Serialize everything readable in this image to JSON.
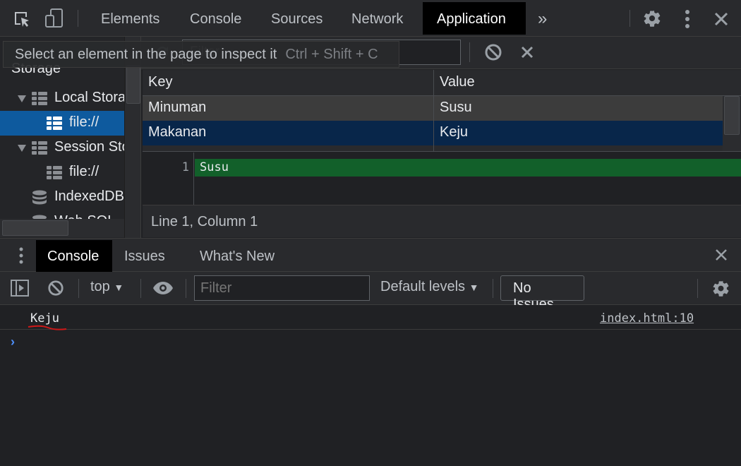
{
  "topbar": {
    "tabs": [
      {
        "label": "Elements",
        "active": false
      },
      {
        "label": "Console",
        "active": false
      },
      {
        "label": "Sources",
        "active": false
      },
      {
        "label": "Network",
        "active": false
      },
      {
        "label": "Application",
        "active": true
      }
    ],
    "more_tabs": "»",
    "icons": [
      "inspect-element-icon",
      "device-toolbar-icon",
      "settings-icon",
      "more-vertical-icon",
      "close-icon"
    ]
  },
  "tooltip": {
    "text": "Select an element in the page to inspect it",
    "shortcut": "Ctrl + Shift + C"
  },
  "app_toolbar": {
    "filter_placeholder": "Filter"
  },
  "sidebar": {
    "section_title": "Storage",
    "items": [
      {
        "label": "Local Storage",
        "icon": "grid",
        "expanded": true,
        "level": 0
      },
      {
        "label": "file://",
        "icon": "grid",
        "selected": true,
        "level": 1
      },
      {
        "label": "Session Storage",
        "icon": "grid",
        "expanded": true,
        "level": 0
      },
      {
        "label": "file://",
        "icon": "grid",
        "level": 1
      },
      {
        "label": "IndexedDB",
        "icon": "database",
        "level": 0
      },
      {
        "label": "Web SQL",
        "icon": "database",
        "level": 0
      }
    ]
  },
  "table": {
    "columns": [
      "Key",
      "Value"
    ],
    "rows": [
      {
        "key": "Minuman",
        "value": "Susu"
      },
      {
        "key": "Makanan",
        "value": "Keju"
      }
    ]
  },
  "preview": {
    "line_number": "1",
    "content": "Susu",
    "status": "Line 1, Column 1"
  },
  "drawer": {
    "tabs": [
      {
        "label": "Console",
        "active": true
      },
      {
        "label": "Issues",
        "active": false
      },
      {
        "label": "What's New",
        "active": false
      }
    ]
  },
  "console_toolbar": {
    "context": "top",
    "filter_placeholder": "Filter",
    "levels": "Default levels",
    "issues": "No Issues"
  },
  "console": {
    "messages": [
      {
        "text": "Keju",
        "source": "index.html:10"
      }
    ],
    "prompt": "›"
  },
  "colors": {
    "selection": "#0e5a9e",
    "row_selected": "#08264a",
    "preview_highlight": "#12602a",
    "prompt": "#4d90fe",
    "annotation_underline": "#d01818"
  }
}
